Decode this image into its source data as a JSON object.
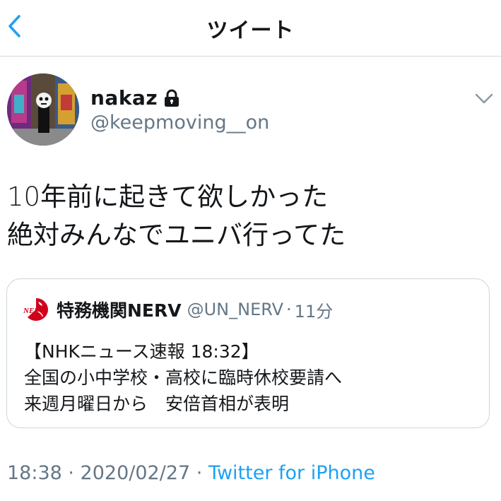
{
  "header": {
    "title": "ツイート",
    "back_icon": "chevron-left-icon",
    "accent_color": "#1da1f2"
  },
  "tweet": {
    "display_name": "nakaz",
    "protected_icon": "lock-icon",
    "handle": "@keepmoving__on",
    "text_lines": [
      "10年前に起きて欲しかった",
      "絶対みんなでユニバ行ってた"
    ],
    "timestamp": "18:38 · 2020/02/27 · ",
    "source": "Twitter for iPhone"
  },
  "quoted": {
    "name": "特務機関NERV",
    "handle": "@UN_NERV",
    "separator": "·",
    "time": "11分",
    "lines": [
      "【NHKニュース速報 18:32】",
      "全国の小中学校・高校に臨時休校要請へ",
      "来週月曜日から　安倍首相が表明"
    ]
  },
  "colors": {
    "text": "#14171a",
    "secondary": "#657786",
    "link": "#1da1f2",
    "border": "#ccd6dd",
    "nerv_red": "#d0021b"
  }
}
